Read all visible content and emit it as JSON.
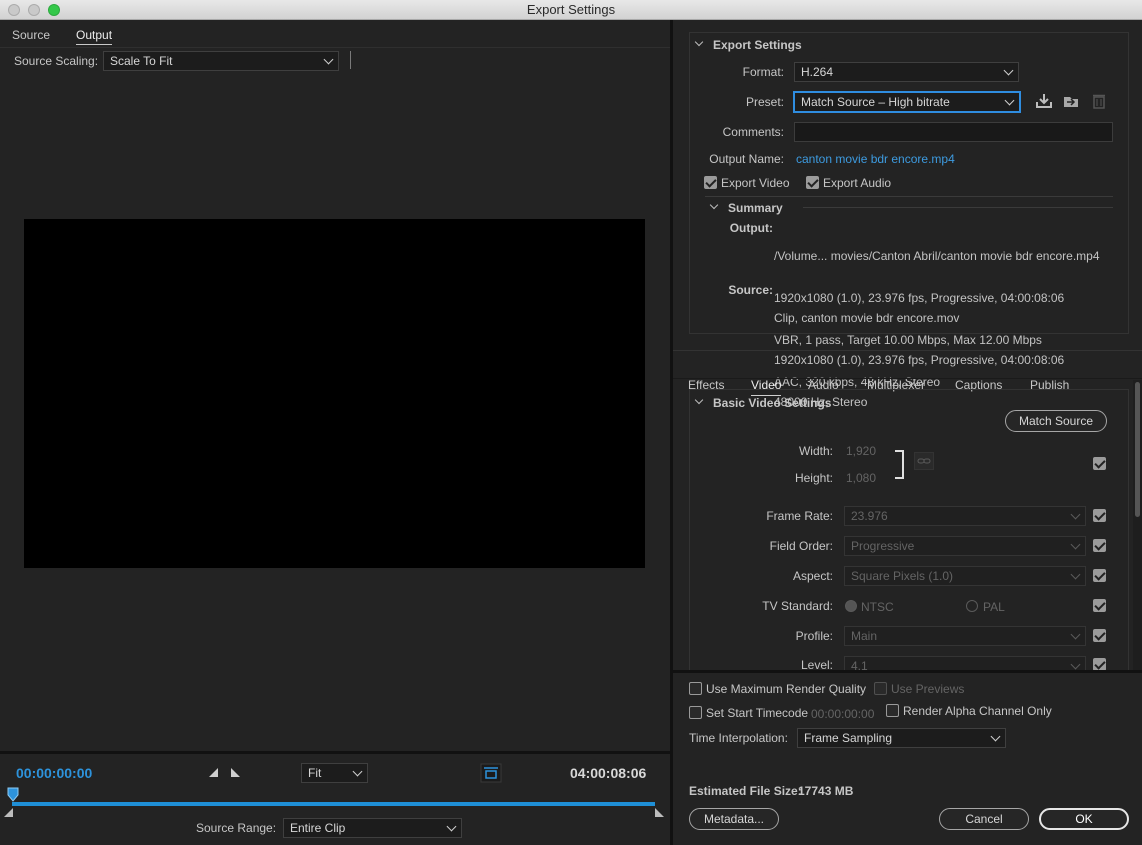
{
  "window": {
    "title": "Export Settings"
  },
  "colors": {
    "accent_blue": "#1f8fd6",
    "link_blue": "#3d9be0",
    "close": "#fc605c",
    "minimize": "#fdbc40",
    "zoom": "#34c84a"
  },
  "left": {
    "tabs": [
      {
        "label": "Source"
      },
      {
        "label": "Output"
      }
    ],
    "active_tab": "Output",
    "source_scaling": {
      "label": "Source Scaling:",
      "value": "Scale To Fit"
    },
    "timeline": {
      "current_time": "00:00:00:00",
      "end_time": "04:00:08:06",
      "zoom": {
        "value": "Fit"
      },
      "source_range": {
        "label": "Source Range:",
        "value": "Entire Clip"
      }
    }
  },
  "export": {
    "section_title": "Export Settings",
    "format": {
      "label": "Format:",
      "value": "H.264"
    },
    "preset": {
      "label": "Preset:",
      "value": "Match Source – High bitrate"
    },
    "comments": {
      "label": "Comments:",
      "value": ""
    },
    "output_name": {
      "label": "Output Name:",
      "value": "canton movie bdr encore.mp4"
    },
    "export_video": {
      "label": "Export Video",
      "checked": true
    },
    "export_audio": {
      "label": "Export Audio",
      "checked": true
    },
    "summary": {
      "title": "Summary",
      "output_label": "Output:",
      "output_lines": [
        "/Volume... movies/Canton Abril/canton movie bdr encore.mp4",
        "1920x1080 (1.0), 23.976 fps, Progressive, 04:00:08:06",
        "VBR, 1 pass, Target 10.00 Mbps, Max 12.00 Mbps",
        "AAC, 320 kbps, 48 kHz, Stereo"
      ],
      "source_label": "Source:",
      "source_lines": [
        "Clip, canton movie bdr encore.mov",
        "1920x1080 (1.0), 23.976 fps, Progressive, 04:00:08:06",
        "48000 Hz, Stereo"
      ]
    }
  },
  "settings_tabs": [
    {
      "label": "Effects"
    },
    {
      "label": "Video"
    },
    {
      "label": "Audio"
    },
    {
      "label": "Multiplexer"
    },
    {
      "label": "Captions"
    },
    {
      "label": "Publish"
    }
  ],
  "active_settings_tab": "Video",
  "video": {
    "section_title": "Basic Video Settings",
    "match_source_button": "Match Source",
    "width": {
      "label": "Width:",
      "value": "1,920"
    },
    "height": {
      "label": "Height:",
      "value": "1,080"
    },
    "frame_rate": {
      "label": "Frame Rate:",
      "value": "23.976"
    },
    "field_order": {
      "label": "Field Order:",
      "value": "Progressive"
    },
    "aspect": {
      "label": "Aspect:",
      "value": "Square Pixels (1.0)"
    },
    "tv_standard": {
      "label": "TV Standard:",
      "ntsc": "NTSC",
      "pal": "PAL"
    },
    "profile": {
      "label": "Profile:",
      "value": "Main"
    },
    "level": {
      "label": "Level:",
      "value": "4.1"
    }
  },
  "bottom": {
    "max_render_quality": "Use Maximum Render Quality",
    "use_previews": "Use Previews",
    "set_start_timecode": "Set Start Timecode",
    "start_timecode_value": "00:00:00:00",
    "render_alpha": "Render Alpha Channel Only",
    "time_interpolation": {
      "label": "Time Interpolation:",
      "value": "Frame Sampling"
    },
    "estimated_size": {
      "label": "Estimated File Size:",
      "value": "17743 MB"
    },
    "metadata_button": "Metadata...",
    "cancel_button": "Cancel",
    "ok_button": "OK"
  }
}
